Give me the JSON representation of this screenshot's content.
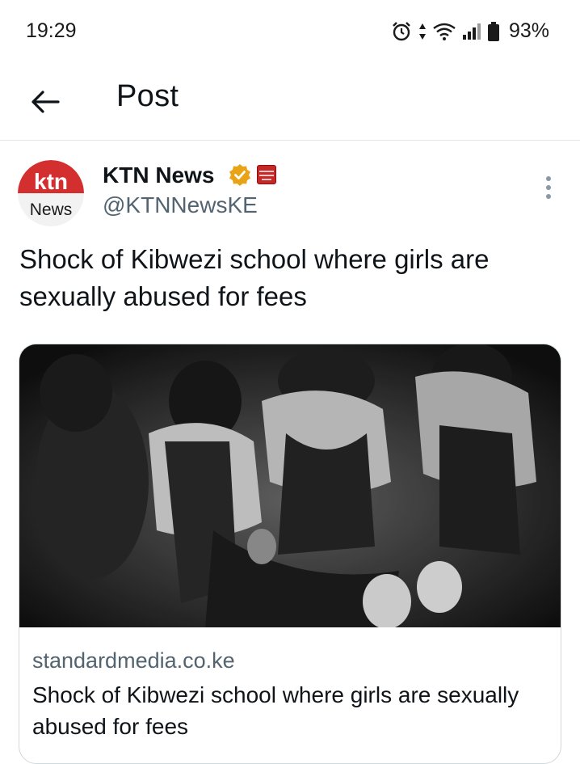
{
  "status_bar": {
    "time": "19:29",
    "battery": "93%",
    "icons": [
      "alarm-icon",
      "data-arrows-icon",
      "wifi-icon",
      "signal-icon",
      "battery-icon"
    ]
  },
  "header": {
    "title": "Post",
    "back_icon": "arrow-left-icon"
  },
  "post": {
    "author": {
      "name": "KTN News",
      "handle": "@KTNNewsKE",
      "avatar_text_top": "ktn",
      "avatar_text_bottom": "News",
      "verified_badge_color": "#e8a317",
      "affiliate_badge_color": "#c62828"
    },
    "text": "Shock of Kibwezi school where girls are sexually abused for fees",
    "link_card": {
      "domain": "standardmedia.co.ke",
      "title": "Shock of Kibwezi school where girls are sexually abused for fees",
      "image_icon": "news-photo-image"
    }
  },
  "colors": {
    "primary_text": "#0f1419",
    "secondary_text": "#536471",
    "border": "#cfd9de",
    "ktn_red": "#d32f2f"
  }
}
